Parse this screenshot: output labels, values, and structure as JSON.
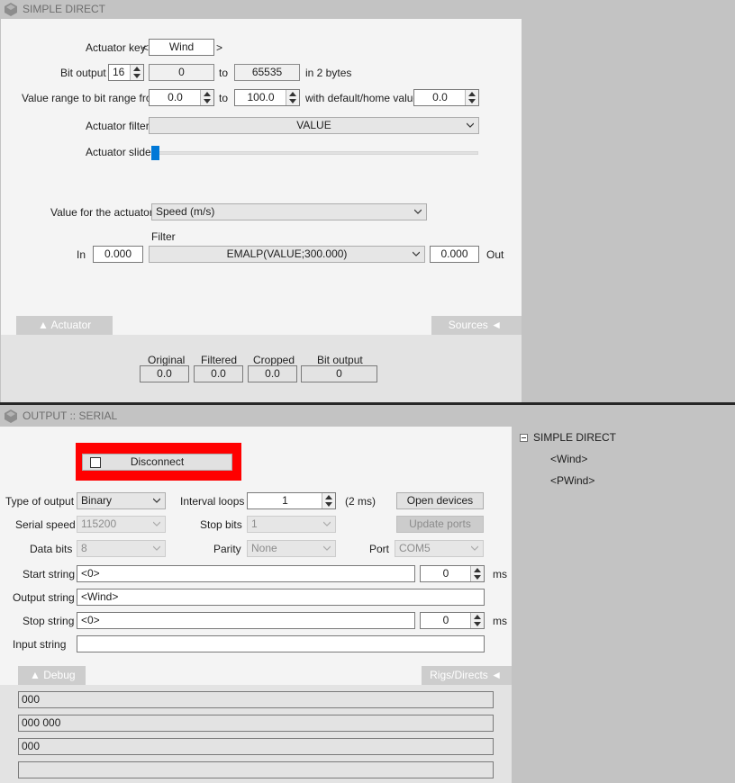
{
  "simple_direct": {
    "title": "SIMPLE DIRECT",
    "actuator_key_label": "Actuator key",
    "actuator_key_lt": "<",
    "actuator_key_gt": ">",
    "actuator_key_value": "Wind",
    "bit_output_label": "Bit output",
    "bit_output_value": "16",
    "bit_from": "0",
    "to1": "to",
    "bit_to": "65535",
    "bytes_label": "in 2 bytes",
    "value_range_label": "Value range to bit range from",
    "range_from": "0.0",
    "to2": "to",
    "range_to": "100.0",
    "default_label": "with default/home value",
    "default_value": "0.0",
    "actuator_filter_label": "Actuator filter",
    "actuator_filter_value": "VALUE",
    "actuator_slider_label": "Actuator slider",
    "slider_value_fraction": 0,
    "value_for_actuator_label": "Value for the actuator",
    "value_for_actuator_value": "Speed (m/s)",
    "filter_label": "Filter",
    "in_label": "In",
    "in_value": "0.000",
    "filter_value": "EMALP(VALUE;300.000)",
    "out_value": "0.000",
    "out_label": "Out",
    "tab_actuator": "▲  Actuator",
    "tab_sources": "Sources  ◄",
    "stats": {
      "original_label": "Original",
      "original_value": "0.0",
      "filtered_label": "Filtered",
      "filtered_value": "0.0",
      "cropped_label": "Cropped",
      "cropped_value": "0.0",
      "bit_output_label": "Bit output",
      "bit_output_value": "0"
    }
  },
  "output_serial": {
    "title": "OUTPUT :: SERIAL",
    "disconnect_label": "Disconnect",
    "type_of_output_label": "Type of output",
    "type_of_output_value": "Binary",
    "interval_loops_label": "Interval loops",
    "interval_loops_value": "1",
    "interval_ms": "(2 ms)",
    "open_devices_label": "Open devices",
    "serial_speed_label": "Serial speed",
    "serial_speed_value": "115200",
    "stop_bits_label": "Stop bits",
    "stop_bits_value": "1",
    "update_ports_label": "Update ports",
    "data_bits_label": "Data bits",
    "data_bits_value": "8",
    "parity_label": "Parity",
    "parity_value": "None",
    "port_label": "Port",
    "port_value": "COM5",
    "start_string_label": "Start string",
    "start_string_value": "<0>",
    "start_ms_value": "0",
    "ms1": "ms",
    "output_string_label": "Output string",
    "output_string_value": "<Wind>",
    "stop_string_label": "Stop string",
    "stop_string_value": "<0>",
    "stop_ms_value": "0",
    "ms2": "ms",
    "input_string_label": "Input string",
    "input_string_value": "",
    "tab_debug": "▲  Debug",
    "tab_rigs": "Rigs/Directs  ◄",
    "debug_lines": [
      "000",
      "000 000",
      "000",
      ""
    ]
  },
  "tree": {
    "root_label": "SIMPLE DIRECT",
    "children": [
      "<Wind>",
      "<PWind>"
    ]
  },
  "colors": {
    "accent": "#0078d7",
    "highlight_frame": "#ff0000"
  }
}
